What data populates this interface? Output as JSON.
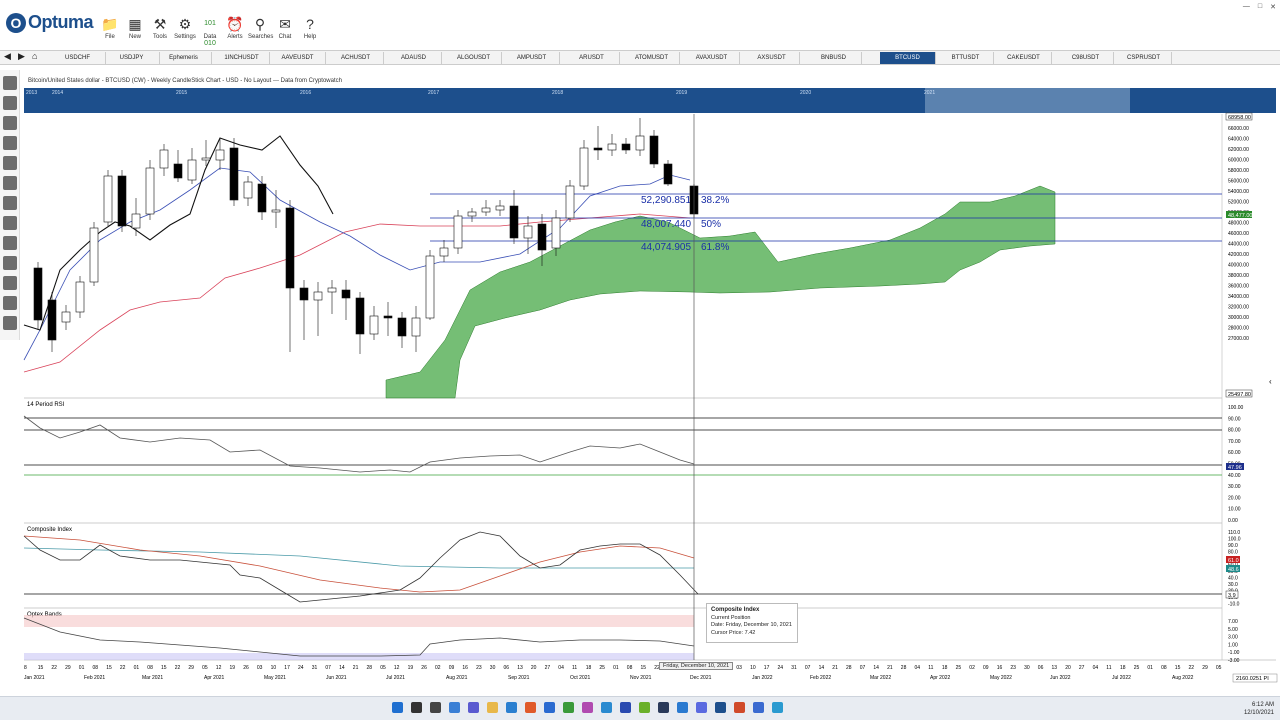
{
  "app": {
    "name": "Optuma"
  },
  "ribbon": [
    {
      "label": "File",
      "icon": "folder-icon"
    },
    {
      "label": "New",
      "icon": "new-icon"
    },
    {
      "label": "Tools",
      "icon": "tools-icon"
    },
    {
      "label": "Settings",
      "icon": "gear-icon"
    },
    {
      "label": "Ephemeris",
      "icon": "ephemeris-icon"
    },
    {
      "label": "Data",
      "icon": "data-icon"
    },
    {
      "label": "Alerts",
      "icon": "alert-icon"
    },
    {
      "label": "Searches",
      "icon": "search-icon"
    },
    {
      "label": "Chat",
      "icon": "chat-icon"
    },
    {
      "label": "Help",
      "icon": "help-icon"
    }
  ],
  "tabs": [
    "USDCHF",
    "USDJPY",
    "Ephemeris",
    "1INCHUSDT",
    "AAVEUSDT",
    "ACHUSDT",
    "ADAUSD",
    "ALGOUSDT",
    "AMPUSDT",
    "ARUSDT",
    "ATOMUSDT",
    "AVAXUSDT",
    "AXSUSDT",
    "BNBUSD",
    "BTCUSD",
    "BTTUSDT",
    "CAKEUSDT",
    "C98USDT",
    "CSPRUSDT"
  ],
  "active_tab": "BTCUSD",
  "chart_title": "Bitcoin/United States dollar - BTCUSD (CW) - Weekly CandleStick Chart - USD - No Layout --- Data from Cryptowatch",
  "overview_years": [
    "2013",
    "2014",
    "2015",
    "2016",
    "2017",
    "2018",
    "2019",
    "2020",
    "2021"
  ],
  "fib": [
    {
      "price": "52,290.851",
      "pct": "38.2%"
    },
    {
      "price": "48,007.440",
      "pct": "50%"
    },
    {
      "price": "44,074.905",
      "pct": "61.8%"
    }
  ],
  "price_axis": [
    "66000.00",
    "64000.00",
    "62000.00",
    "60000.00",
    "58000.00",
    "56000.00",
    "54000.00",
    "52000.00",
    "50000.00",
    "48000.00",
    "46000.00",
    "44000.00",
    "42000.00",
    "40000.00",
    "38000.00",
    "36000.00",
    "34000.00",
    "32000.00",
    "30000.00",
    "28000.00",
    "27000.00"
  ],
  "price_top": "68958.00",
  "price_bottom": "25497.80",
  "price_current": "48,477.00",
  "rsi": {
    "title": "14 Period RSI",
    "axis": [
      "100.00",
      "90.00",
      "80.00",
      "70.00",
      "60.00",
      "50.00",
      "40.00",
      "30.00",
      "20.00",
      "10.00",
      "0.00"
    ],
    "current": "47.96"
  },
  "composite": {
    "title": "Composite Index",
    "axis": [
      "110.0",
      "100.0",
      "90.0",
      "80.0",
      "70.0",
      "60.0",
      "50.0",
      "40.0",
      "30.0",
      "20.0",
      "10.0",
      "-10.0"
    ],
    "red_val": "61.0",
    "teal_val": "48.6",
    "cur_val": "3.9"
  },
  "optex": {
    "title": "Optex Bands",
    "axis": [
      "7.00",
      "5.00",
      "3.00",
      "1.00",
      "-1.00",
      "-3.00"
    ]
  },
  "tooltip": {
    "title": "Composite Index",
    "line1": "Current Position",
    "line2": "Date: Friday, December 10, 2021",
    "line3": "Cursor Price: 7.42"
  },
  "date_box": "Friday, December 10, 2021",
  "date_days": [
    "8",
    "15",
    "22",
    "29",
    "01",
    "08",
    "15",
    "22",
    "01",
    "08",
    "15",
    "22",
    "29",
    "05",
    "12",
    "19",
    "26",
    "03",
    "10",
    "17",
    "24",
    "31",
    "07",
    "14",
    "21",
    "28",
    "05",
    "12",
    "19",
    "26",
    "02",
    "09",
    "16",
    "23",
    "30",
    "06",
    "13",
    "20",
    "27",
    "04",
    "11",
    "18",
    "25",
    "01",
    "08",
    "15",
    "22",
    "29",
    "06",
    "13",
    "20",
    "27",
    "03",
    "10",
    "17",
    "24",
    "31",
    "07",
    "14",
    "21",
    "28",
    "07",
    "14",
    "21",
    "28",
    "04",
    "11",
    "18",
    "25",
    "02",
    "09",
    "16",
    "23",
    "30",
    "06",
    "13",
    "20",
    "27",
    "04",
    "11",
    "18",
    "25",
    "01",
    "08",
    "15",
    "22",
    "29",
    "05",
    "12",
    "19",
    "26",
    "02"
  ],
  "date_months": [
    "Jan 2021",
    "Feb 2021",
    "Mar 2021",
    "Apr 2021",
    "May 2021",
    "Jun 2021",
    "Jul 2021",
    "Aug 2021",
    "Sep 2021",
    "Oct 2021",
    "Nov 2021",
    "Dec 2021",
    "Jan 2022",
    "Feb 2022",
    "Mar 2022",
    "Apr 2022",
    "May 2022",
    "Jun 2022",
    "Jul 2022",
    "Aug 2022"
  ],
  "footer_value": "2160.0251 PI",
  "clock": {
    "time": "6:12 AM",
    "date": "12/10/2021"
  },
  "colors": {
    "accent": "#1d4f8c",
    "cloud": "#3aa33a",
    "kijun": "#d9435a",
    "tenkan": "#3a4fb5",
    "fib": "#1a2fa8"
  }
}
